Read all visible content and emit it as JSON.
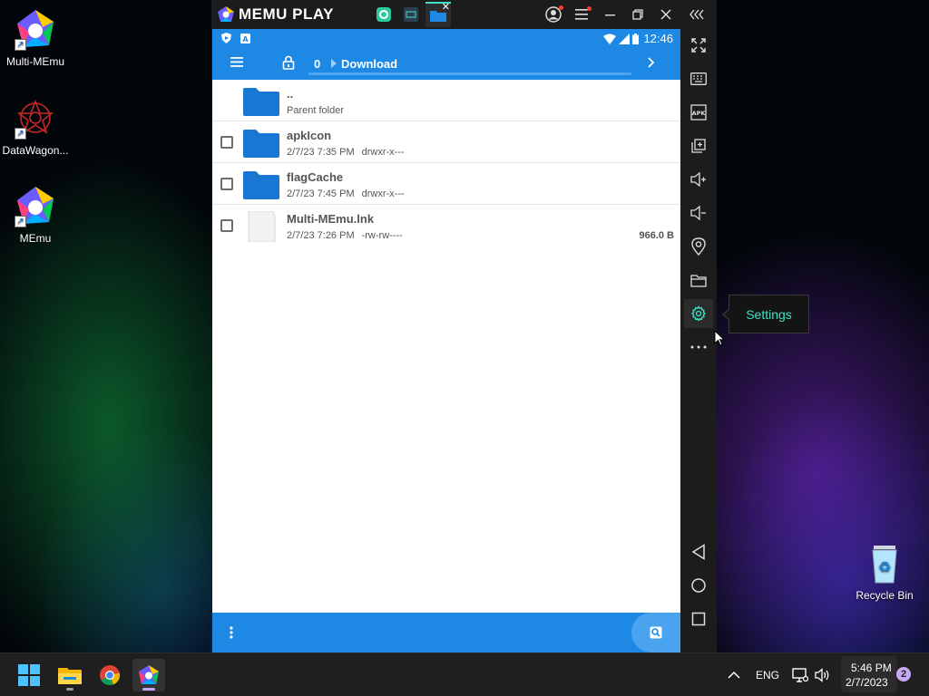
{
  "desktop": {
    "icons": [
      {
        "label": "Multi-MEmu"
      },
      {
        "label": "DataWagon..."
      },
      {
        "label": "MEmu"
      },
      {
        "label": "Recycle Bin"
      }
    ]
  },
  "window": {
    "title": "MEMU PLAY"
  },
  "android": {
    "status_time": "12:46",
    "appbar": {
      "counter": "0",
      "path": "Download"
    },
    "parent_folder": {
      "name": "..",
      "subtitle": "Parent folder"
    },
    "files": [
      {
        "name": "apkIcon",
        "date": "2/7/23 7:35 PM",
        "perm": "drwxr-x---",
        "size": ""
      },
      {
        "name": "flagCache",
        "date": "2/7/23 7:45 PM",
        "perm": "drwxr-x---",
        "size": ""
      },
      {
        "name": "Multi-MEmu.lnk",
        "date": "2/7/23 7:26 PM",
        "perm": "-rw-rw----",
        "size": "966.0 B"
      }
    ]
  },
  "sidebar": {
    "tooltip": "Settings"
  },
  "taskbar": {
    "language": "ENG",
    "time": "5:46 PM",
    "date": "2/7/2023",
    "notification_count": "2"
  },
  "colors": {
    "android_blue": "#1e88e5",
    "folder_blue": "#1976d2",
    "tooltip_text": "#3ee0c4"
  }
}
